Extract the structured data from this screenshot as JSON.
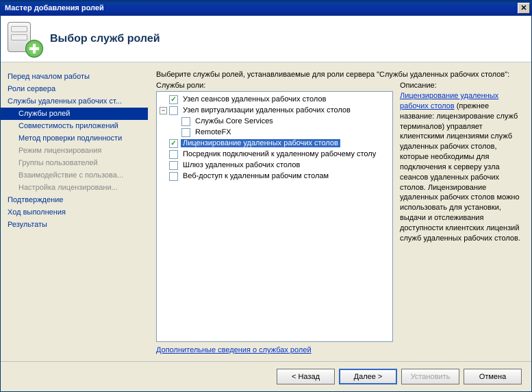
{
  "window_title": "Мастер добавления ролей",
  "header_title": "Выбор служб ролей",
  "sidebar": [
    {
      "label": "Перед началом работы",
      "indent": false
    },
    {
      "label": "Роли сервера",
      "indent": false
    },
    {
      "label": "Службы удаленных рабочих ст...",
      "indent": false
    },
    {
      "label": "Службы ролей",
      "indent": true,
      "active": true
    },
    {
      "label": "Совместимость приложений",
      "indent": true
    },
    {
      "label": "Метод проверки подлинности",
      "indent": true
    },
    {
      "label": "Режим лицензирования",
      "indent": true,
      "disabled": true
    },
    {
      "label": "Группы пользователей",
      "indent": true,
      "disabled": true
    },
    {
      "label": "Взаимодействие с пользова...",
      "indent": true,
      "disabled": true
    },
    {
      "label": "Настройка лицензировани...",
      "indent": true,
      "disabled": true
    },
    {
      "label": "Подтверждение",
      "indent": false
    },
    {
      "label": "Ход выполнения",
      "indent": false
    },
    {
      "label": "Результаты",
      "indent": false
    }
  ],
  "instruction": "Выберите службы ролей, устанавливаемые для роли сервера \"Службы удаленных рабочих столов\":",
  "left_label": "Службы роли:",
  "right_label": "Описание:",
  "tree": [
    {
      "depth": 0,
      "expander": "",
      "checked": true,
      "label": "Узел сеансов удаленных рабочих столов"
    },
    {
      "depth": 0,
      "expander": "−",
      "checked": false,
      "label": "Узел виртуализации удаленных рабочих столов"
    },
    {
      "depth": 1,
      "expander": "",
      "checked": false,
      "label": "Службы Core Services"
    },
    {
      "depth": 1,
      "expander": "",
      "checked": false,
      "label": "RemoteFX"
    },
    {
      "depth": 0,
      "expander": "",
      "checked": true,
      "label": "Лицензирование удаленных рабочих столов",
      "selected": true
    },
    {
      "depth": 0,
      "expander": "",
      "checked": false,
      "label": "Посредник подключений к удаленному рабочему столу"
    },
    {
      "depth": 0,
      "expander": "",
      "checked": false,
      "label": "Шлюз удаленных рабочих столов"
    },
    {
      "depth": 0,
      "expander": "",
      "checked": false,
      "label": "Веб-доступ к удаленным рабочим столам"
    }
  ],
  "description": {
    "link": "Лицензирование удаленных рабочих столов",
    "rest": " (прежнее название: лицензирование служб терминалов) управляет клиентскими лицензиями служб удаленных рабочих столов, которые необходимы для подключения к серверу узла сеансов удаленных рабочих столов. Лицензирование удаленных рабочих столов можно использовать для установки, выдачи и отслеживания доступности клиентских лицензий служб удаленных рабочих столов."
  },
  "more_link": "Дополнительные сведения о службах ролей",
  "buttons": {
    "back": "< Назад",
    "next": "Далее >",
    "install": "Установить",
    "cancel": "Отмена"
  }
}
